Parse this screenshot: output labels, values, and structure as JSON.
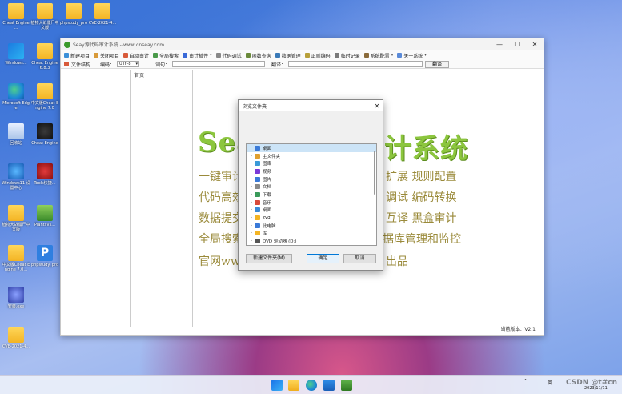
{
  "desktop": {
    "icons": [
      {
        "label": "Cheat Engine ...",
        "icon": "folder"
      },
      {
        "label": "植物大战僵尸中文版",
        "icon": "folder"
      },
      {
        "label": "phpstudy_pro",
        "icon": "folder"
      },
      {
        "label": "CVE-2021-4...",
        "icon": "folder"
      },
      {
        "label": "Windows...",
        "icon": "windows"
      },
      {
        "label": "Cheat Engine 6.8.3",
        "icon": "folder"
      },
      {
        "label": "Microsoft Edge",
        "icon": "edge"
      },
      {
        "label": "中文版Cheat Engine 7.0",
        "icon": "folder"
      },
      {
        "label": "回收站",
        "icon": "recycle-bin"
      },
      {
        "label": "Cheat Engine",
        "icon": "cheat-engine"
      },
      {
        "label": "Windows11 设置中心",
        "icon": "gear"
      },
      {
        "label": "Tools快捷...",
        "icon": "tool"
      },
      {
        "label": "植物大战僵尸中文版",
        "icon": "folder"
      },
      {
        "label": "PlantsVs...",
        "icon": "plants"
      },
      {
        "label": "中文版Cheat Engine 7.0...",
        "icon": "folder"
      },
      {
        "label": "phpstudy_pro",
        "icon": "phpstudy"
      },
      {
        "label": "安装.exe",
        "icon": "setup"
      },
      {
        "label": "CVE-2021-4...",
        "icon": "folder"
      }
    ]
  },
  "window": {
    "title": "Seay源代码审计系统 --www.cnseay.com",
    "controls": {
      "minimize": "—",
      "maximize": "☐",
      "close": "✕"
    },
    "menu": [
      {
        "label": "新建项目",
        "color": "#3a8fd8",
        "dropdown": false
      },
      {
        "label": "关闭项目",
        "color": "#d89a3a",
        "dropdown": false
      },
      {
        "label": "自动审计",
        "color": "#d85a3a",
        "dropdown": false
      },
      {
        "label": "全局搜索",
        "color": "#4a9a4a",
        "dropdown": false
      },
      {
        "label": "审计插件",
        "color": "#3a6ad8",
        "dropdown": true
      },
      {
        "label": "代码调试",
        "color": "#888888",
        "dropdown": false
      },
      {
        "label": "函数查询",
        "color": "#6a8a3a",
        "dropdown": false
      },
      {
        "label": "数据管理",
        "color": "#3a7ab8",
        "dropdown": false
      },
      {
        "label": "正则编码",
        "color": "#b8a03a",
        "dropdown": false
      },
      {
        "label": "临时记录",
        "color": "#7a7a7a",
        "dropdown": false
      },
      {
        "label": "系统配置",
        "color": "#8a6a3a",
        "dropdown": true
      },
      {
        "label": "关于系统",
        "color": "#5a8ad8",
        "dropdown": true
      }
    ],
    "toolbar": {
      "file_structure": "文件结构",
      "encoding_label": "编码：",
      "encoding_value": "UTF-8",
      "word_label": "词句：",
      "translate_label": "翻译：",
      "translate_button": "翻译"
    },
    "tab": "首页",
    "banner": {
      "title_left": "Sea",
      "title_right": "计系统",
      "lines": [
        {
          "left": "一键审计",
          "right": "扩展  规则配置"
        },
        {
          "left": "代码高效",
          "right": "调试  编码转换"
        },
        {
          "left": "数据提交",
          "right": "互译  黑盒审计"
        },
        {
          "left": "全局搜索",
          "right": "据库管理和监控"
        },
        {
          "left": "官网www",
          "right": "出品"
        }
      ]
    },
    "status": "当前版本：V2.1"
  },
  "dialog": {
    "title": "浏览文件夹",
    "tree": [
      {
        "label": "桌面",
        "icon": "desktop",
        "color": "#3a7ad8",
        "expander": "",
        "selected": true
      },
      {
        "label": "主文件夹",
        "icon": "home",
        "color": "#e0a030",
        "expander": "›",
        "selected": false
      },
      {
        "label": "图库",
        "icon": "gallery",
        "color": "#3a9ad8",
        "expander": "›",
        "selected": false
      },
      {
        "label": "视频",
        "icon": "video",
        "color": "#7a3ad8",
        "expander": "›",
        "selected": false
      },
      {
        "label": "图片",
        "icon": "pictures",
        "color": "#3a7ad8",
        "expander": "›",
        "selected": false
      },
      {
        "label": "文档",
        "icon": "documents",
        "color": "#8a8a8a",
        "expander": "›",
        "selected": false
      },
      {
        "label": "下载",
        "icon": "downloads",
        "color": "#3a9a5a",
        "expander": "›",
        "selected": false
      },
      {
        "label": "音乐",
        "icon": "music",
        "color": "#d84a3a",
        "expander": "›",
        "selected": false
      },
      {
        "label": "桌面",
        "icon": "desktop",
        "color": "#3a8ad8",
        "expander": "›",
        "selected": false
      },
      {
        "label": "zyq",
        "icon": "folder",
        "color": "#f3b424",
        "expander": "›",
        "selected": false
      },
      {
        "label": "此电脑",
        "icon": "computer",
        "color": "#3a7ad8",
        "expander": "›",
        "selected": false
      },
      {
        "label": "库",
        "icon": "library",
        "color": "#f3b424",
        "expander": "›",
        "selected": false
      },
      {
        "label": "DVD 驱动器 (D:)",
        "icon": "dvd",
        "color": "#555555",
        "expander": "›",
        "selected": false
      }
    ],
    "buttons": {
      "new_folder": "新建文件夹(M)",
      "ok": "确定",
      "cancel": "取消"
    }
  },
  "taskbar": {
    "apps": [
      "windows-start",
      "file-explorer",
      "edge",
      "store",
      "seay"
    ],
    "tray": {
      "caret": "^",
      "lang": "英",
      "date": "2023/11/11"
    },
    "watermark": "CSDN @t#cn"
  }
}
